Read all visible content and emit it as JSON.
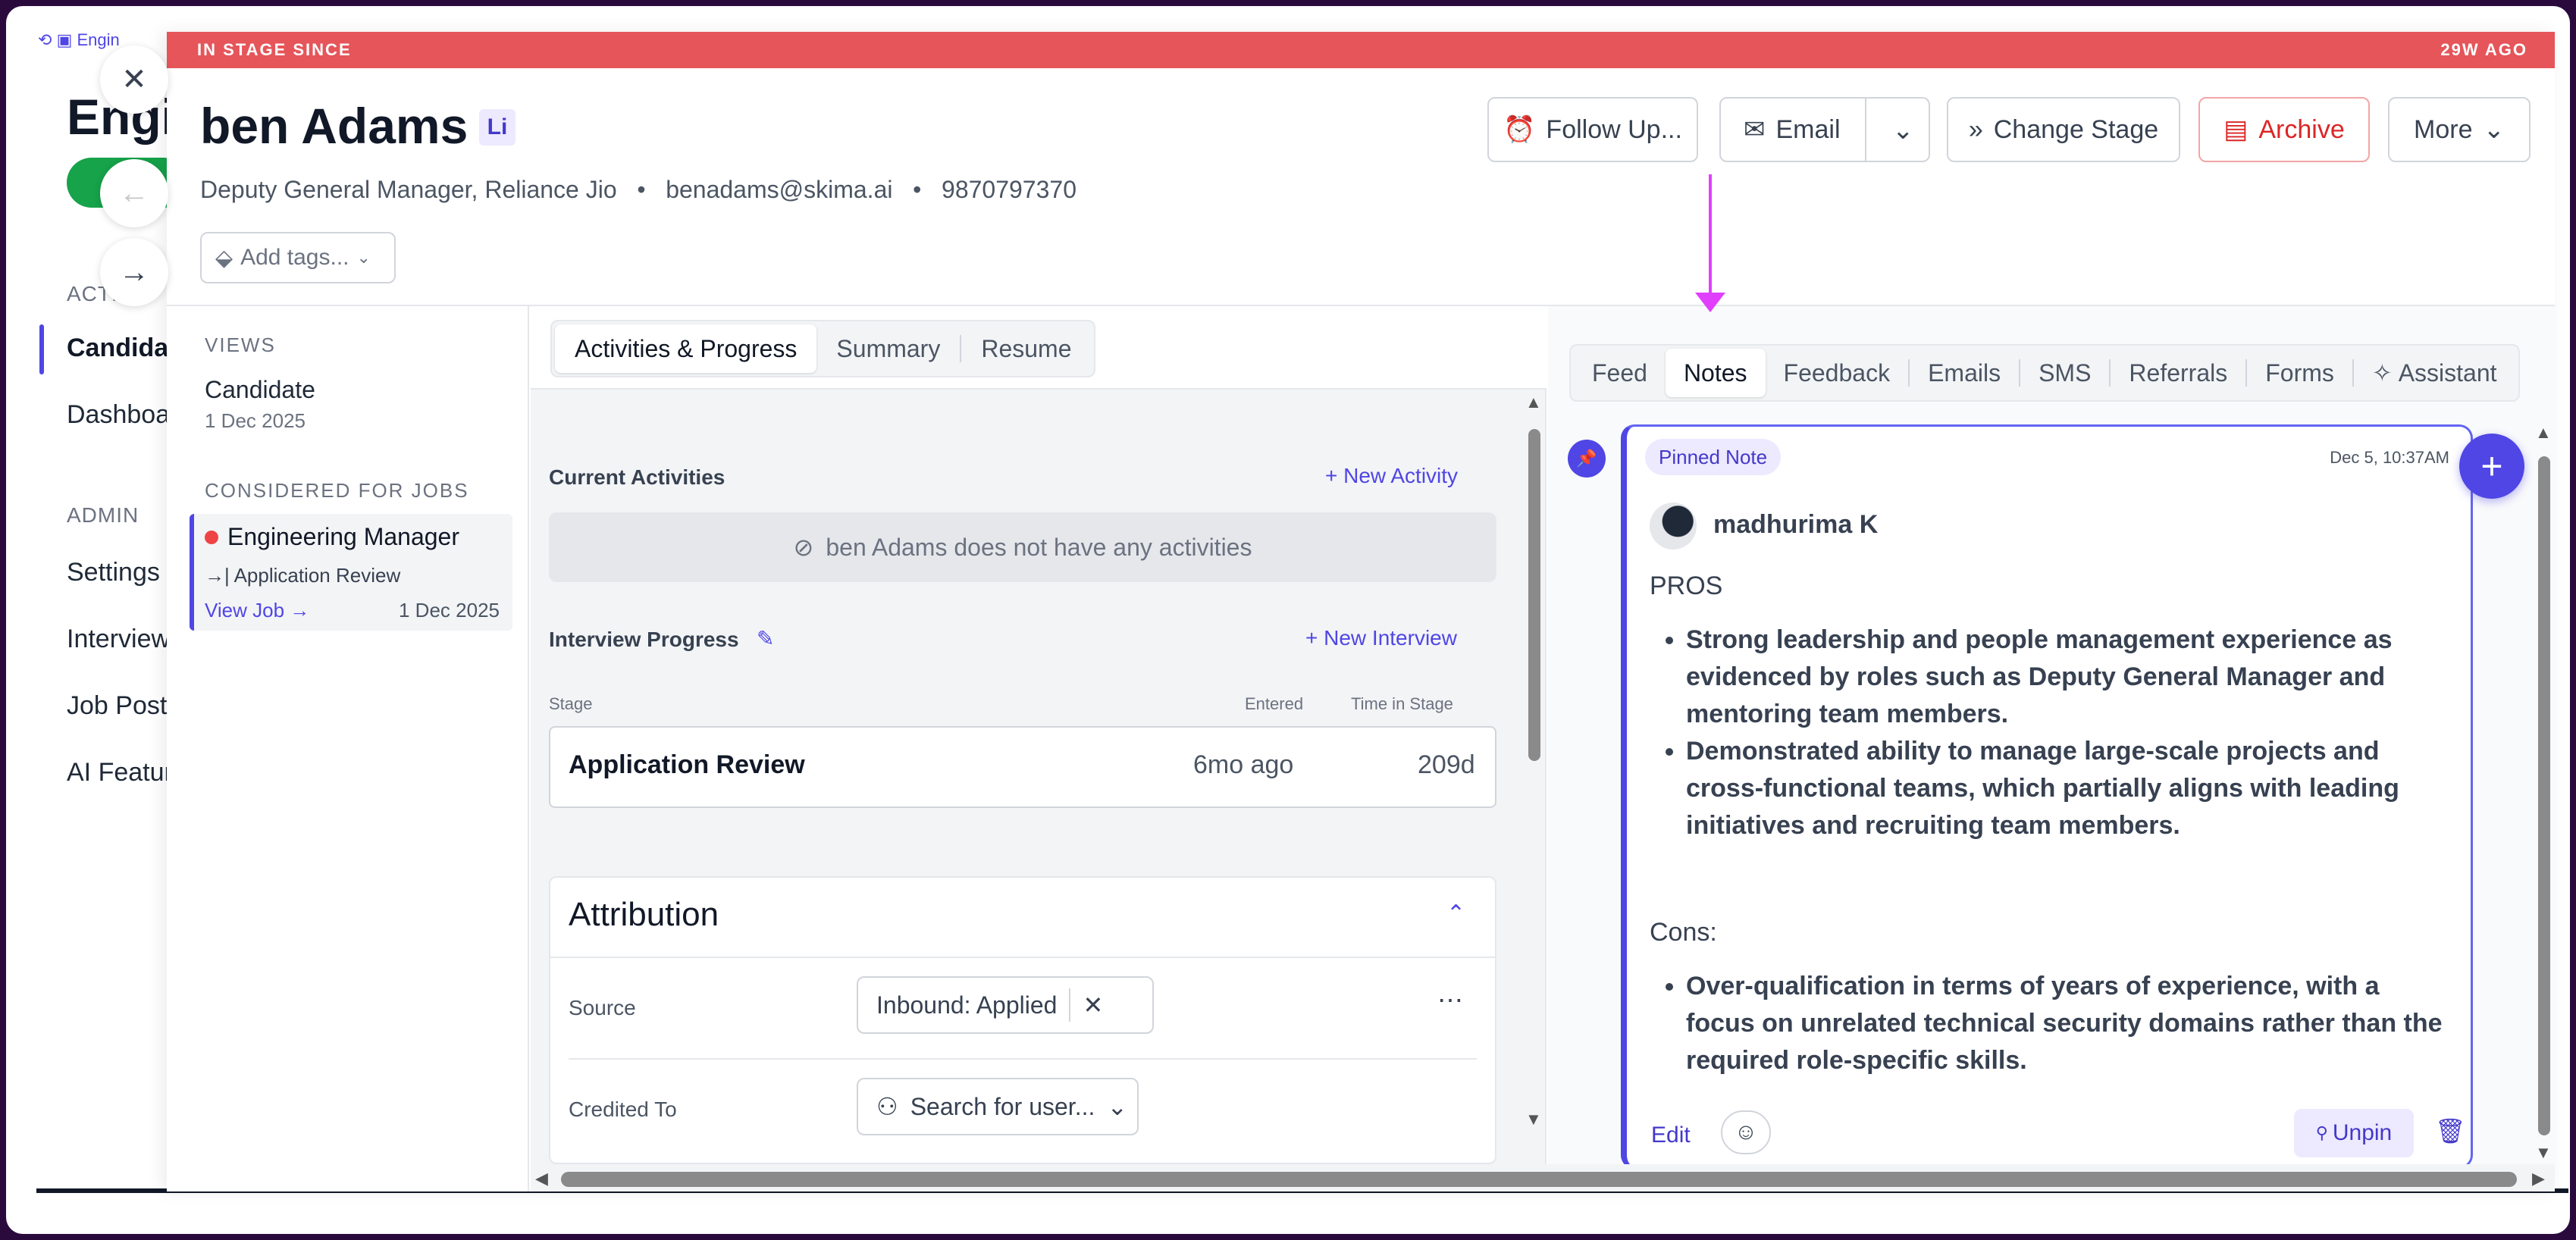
{
  "background": {
    "breadcrumb": "Engin",
    "title": "Engi",
    "sections": {
      "activity": "ACTI",
      "admin": "ADMIN"
    },
    "items": {
      "candidates": "Candidat",
      "dashboard": "Dashboa",
      "settings": "Settings",
      "interviews": "Interview",
      "job_postings": "Job Postin",
      "ai_features": "AI Featur"
    }
  },
  "stage_banner": {
    "left": "IN STAGE SINCE",
    "right": "29W AGO"
  },
  "candidate": {
    "name": "ben Adams",
    "linkedin_badge": "Li",
    "title_company": "Deputy General Manager, Reliance Jio",
    "email": "benadams@skima.ai",
    "phone": "9870797370",
    "separator": "•",
    "tags_placeholder": "Add tags..."
  },
  "header_actions": {
    "follow_up": "Follow Up...",
    "email": "Email",
    "change_stage": "Change Stage",
    "archive": "Archive",
    "more": "More"
  },
  "left_nav": {
    "views_label": "VIEWS",
    "candidate_view": "Candidate",
    "candidate_date": "1 Dec 2025",
    "considered_label": "CONSIDERED FOR JOBS",
    "job": {
      "title": "Engineering Manager",
      "stage_prefix": "→|",
      "stage": "Application Review",
      "view_job": "View Job →",
      "date": "1 Dec 2025"
    }
  },
  "middle": {
    "tabs": [
      "Activities & Progress",
      "Summary",
      "Resume"
    ],
    "current_activities": "Current Activities",
    "new_activity": "+ New Activity",
    "empty_activities": "ben Adams does not have any activities",
    "interview_progress": "Interview Progress",
    "new_interview": "+ New Interview",
    "table_headers": {
      "stage": "Stage",
      "entered": "Entered",
      "time_in_stage": "Time in Stage"
    },
    "progress_row": {
      "stage": "Application Review",
      "entered": "6mo ago",
      "time": "209d"
    },
    "attribution": {
      "title": "Attribution",
      "source_label": "Source",
      "source_value": "Inbound: Applied",
      "credited_label": "Credited To",
      "credited_placeholder": "Search for user..."
    }
  },
  "right": {
    "tabs": [
      "Feed",
      "Notes",
      "Feedback",
      "Emails",
      "SMS",
      "Referrals",
      "Forms",
      "Assistant"
    ],
    "active_tab": "Notes",
    "note": {
      "pinned_label": "Pinned Note",
      "date": "Dec 5, 10:37AM",
      "author": "madhurima K",
      "pros_heading": "PROS",
      "pros": [
        "Strong leadership and people management experience as evidenced by roles such as Deputy General Manager and mentoring team members.",
        "Demonstrated ability to manage large-scale projects and cross-functional teams, which partially aligns with leading initiatives and recruiting team members."
      ],
      "cons_heading": "Cons:",
      "cons": [
        "Over-qualification in terms of years of experience, with a focus on unrelated technical security domains rather than the required role-specific skills."
      ],
      "edit": "Edit",
      "unpin": "Unpin"
    }
  },
  "colors": {
    "accent": "#4f46e5",
    "banner": "#e5555a",
    "archive": "#dc2626",
    "annotation_arrow": "#e040fb"
  }
}
